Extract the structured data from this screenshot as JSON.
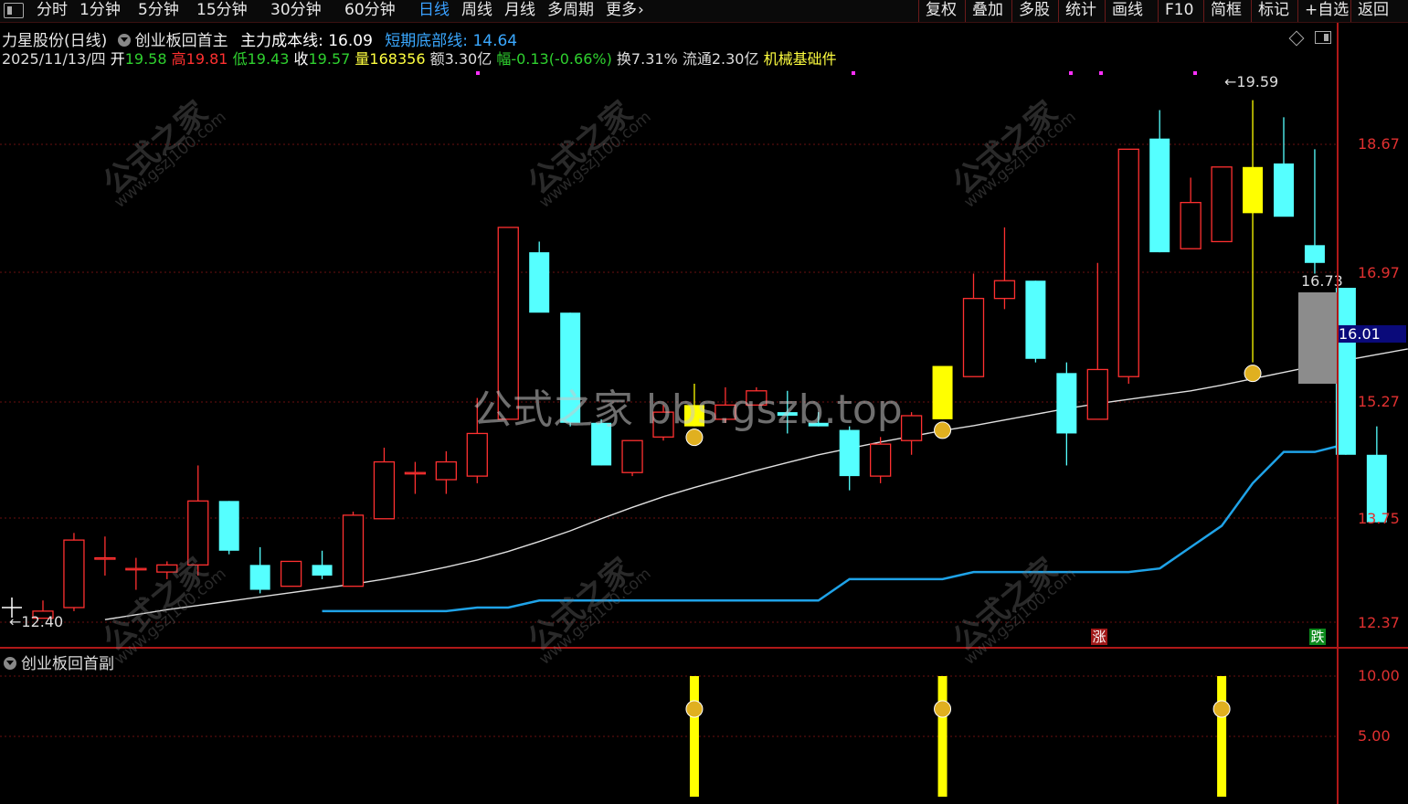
{
  "toolbar": {
    "periods": [
      "分时",
      "1分钟",
      "5分钟",
      "15分钟",
      "30分钟",
      "60分钟",
      "日线",
      "周线",
      "月线",
      "多周期",
      "更多"
    ],
    "active_period": "日线",
    "right_buttons": [
      "复权",
      "叠加",
      "多股",
      "统计",
      "画线",
      "F10",
      "简框",
      "标记",
      "+自选",
      "返回"
    ]
  },
  "stock": {
    "name": "力星股份(日线)",
    "indicator": "创业板回首主",
    "cost_line_label": "主力成本线:",
    "cost_line_value": "16.09",
    "bottom_line_label": "短期底部线:",
    "bottom_line_value": "14.64",
    "date": "2025/11/13/四",
    "open_label": "开",
    "open": "19.58",
    "high_label": "高",
    "high": "19.81",
    "low_label": "低",
    "low": "19.43",
    "close_label": "收",
    "close": "19.57",
    "volume_label": "量",
    "volume": "168356",
    "amount": "额3.30亿",
    "change": "幅-0.13(-0.66%)",
    "turnover": "换7.31%",
    "float": "流通2.30亿",
    "sector": "机械基础件"
  },
  "axis": {
    "price_labels": [
      "18.67",
      "16.97",
      "15.27",
      "13.75",
      "12.37"
    ],
    "current_price": "16.01",
    "sub_labels": [
      "10.00",
      "5.00"
    ],
    "max_marker": "19.59",
    "min_marker": "12.40",
    "last_marker": "16.73"
  },
  "sub_panel": {
    "title": "创业板回首副"
  },
  "badges": {
    "rise": "涨",
    "fall": "跌"
  },
  "watermarks": {
    "big": "公式之家 bbs.gszb.top",
    "cn": "公式之家",
    "url": "www.gszj100.com"
  },
  "colors": {
    "up": "#ff3030",
    "down": "#55ffff",
    "signal": "#ffff00",
    "cost": "#e0e0e0",
    "bottom": "#1fa3e8",
    "grid": "#6a1010"
  },
  "chart_data": {
    "type": "candlestick",
    "price_range": [
      12.0,
      20.1
    ],
    "candles": [
      {
        "o": 12.3,
        "h": 12.55,
        "l": 12.3,
        "c": 12.4
      },
      {
        "o": 12.45,
        "h": 13.5,
        "l": 12.4,
        "c": 13.4
      },
      {
        "o": 13.15,
        "h": 13.45,
        "l": 12.9,
        "c": 13.15
      },
      {
        "o": 13.0,
        "h": 13.15,
        "l": 12.7,
        "c": 13.0
      },
      {
        "o": 12.95,
        "h": 13.1,
        "l": 12.85,
        "c": 13.05
      },
      {
        "o": 13.05,
        "h": 14.45,
        "l": 12.9,
        "c": 13.95
      },
      {
        "o": 13.95,
        "h": 13.95,
        "l": 13.2,
        "c": 13.25
      },
      {
        "o": 13.05,
        "h": 13.3,
        "l": 12.65,
        "c": 12.7
      },
      {
        "o": 12.75,
        "h": 13.1,
        "l": 12.75,
        "c": 13.1
      },
      {
        "o": 13.05,
        "h": 13.25,
        "l": 12.85,
        "c": 12.9
      },
      {
        "o": 12.75,
        "h": 13.8,
        "l": 12.75,
        "c": 13.75
      },
      {
        "o": 13.7,
        "h": 14.7,
        "l": 13.7,
        "c": 14.5
      },
      {
        "o": 14.35,
        "h": 14.5,
        "l": 14.05,
        "c": 14.35
      },
      {
        "o": 14.25,
        "h": 14.65,
        "l": 14.05,
        "c": 14.5
      },
      {
        "o": 14.3,
        "h": 15.4,
        "l": 14.2,
        "c": 14.9
      },
      {
        "o": 15.1,
        "h": 17.8,
        "l": 15.1,
        "c": 17.8
      },
      {
        "o": 17.45,
        "h": 17.6,
        "l": 16.7,
        "c": 16.6
      },
      {
        "o": 16.6,
        "h": 16.6,
        "l": 15.0,
        "c": 15.05
      },
      {
        "o": 15.05,
        "h": 15.1,
        "l": 14.45,
        "c": 14.45
      },
      {
        "o": 14.35,
        "h": 14.75,
        "l": 14.3,
        "c": 14.8
      },
      {
        "o": 14.85,
        "h": 15.3,
        "l": 14.8,
        "c": 15.2
      },
      {
        "o": 15.3,
        "h": 15.6,
        "l": 15.0,
        "c": 15.0
      },
      {
        "o": 15.1,
        "h": 15.55,
        "l": 15.05,
        "c": 15.3
      },
      {
        "o": 15.3,
        "h": 15.55,
        "l": 15.3,
        "c": 15.5
      },
      {
        "o": 15.2,
        "h": 15.5,
        "l": 14.9,
        "c": 15.15
      },
      {
        "o": 15.05,
        "h": 15.2,
        "l": 15.0,
        "c": 15.0
      },
      {
        "o": 14.95,
        "h": 15.0,
        "l": 14.1,
        "c": 14.3
      },
      {
        "o": 14.3,
        "h": 14.85,
        "l": 14.2,
        "c": 14.75
      },
      {
        "o": 14.8,
        "h": 15.2,
        "l": 14.6,
        "c": 15.15
      },
      {
        "o": 15.1,
        "h": 15.8,
        "l": 15.1,
        "c": 15.85
      },
      {
        "o": 15.7,
        "h": 17.15,
        "l": 15.7,
        "c": 16.8
      },
      {
        "o": 16.8,
        "h": 17.8,
        "l": 16.65,
        "c": 17.05
      },
      {
        "o": 17.05,
        "h": 17.05,
        "l": 15.9,
        "c": 15.95
      },
      {
        "o": 15.75,
        "h": 15.9,
        "l": 14.45,
        "c": 14.9
      },
      {
        "o": 15.1,
        "h": 17.3,
        "l": 15.1,
        "c": 15.8
      },
      {
        "o": 15.7,
        "h": 18.9,
        "l": 15.6,
        "c": 18.9
      },
      {
        "o": 19.05,
        "h": 19.45,
        "l": 17.45,
        "c": 17.45
      },
      {
        "o": 17.5,
        "h": 18.5,
        "l": 17.5,
        "c": 18.15
      },
      {
        "o": 17.6,
        "h": 18.6,
        "l": 17.6,
        "c": 18.65
      },
      {
        "o": 18.0,
        "h": 19.59,
        "l": 15.9,
        "c": 18.65
      },
      {
        "o": 18.7,
        "h": 19.35,
        "l": 18.0,
        "c": 17.95
      },
      {
        "o": 17.55,
        "h": 18.9,
        "l": 17.15,
        "c": 17.3
      },
      {
        "o": 16.95,
        "h": 16.95,
        "l": 14.6,
        "c": 14.6
      },
      {
        "o": 14.6,
        "h": 15.0,
        "l": 13.65,
        "c": 13.65
      }
    ],
    "signal_candle_indices": [
      21,
      29,
      39
    ],
    "cost_line": [
      12.28,
      12.35,
      12.42,
      12.48,
      12.54,
      12.6,
      12.66,
      12.72,
      12.78,
      12.85,
      12.93,
      13.02,
      13.12,
      13.24,
      13.38,
      13.53,
      13.7,
      13.86,
      14.01,
      14.14,
      14.26,
      14.38,
      14.49,
      14.6,
      14.69,
      14.78,
      14.86,
      14.94,
      15.01,
      15.09,
      15.17,
      15.25,
      15.32,
      15.38,
      15.44,
      15.5,
      15.58,
      15.67,
      15.76,
      15.85,
      15.93,
      16.01,
      16.09
    ],
    "bottom_line": [
      12.4,
      12.4,
      12.4,
      12.4,
      12.4,
      12.45,
      12.45,
      12.55,
      12.55,
      12.55,
      12.55,
      12.55,
      12.55,
      12.55,
      12.55,
      12.55,
      12.55,
      12.85,
      12.85,
      12.85,
      12.85,
      12.95,
      12.95,
      12.95,
      12.95,
      12.95,
      12.95,
      13.0,
      13.3,
      13.6,
      14.2,
      14.64,
      14.64,
      14.75
    ],
    "sub_bar_indices": [
      21,
      29,
      38
    ],
    "sub_range": [
      0,
      12
    ]
  }
}
